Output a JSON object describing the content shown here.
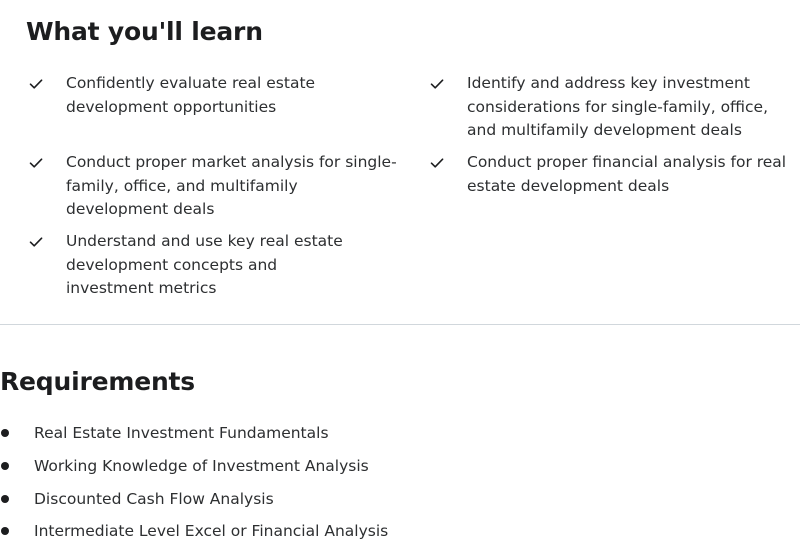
{
  "learn": {
    "title": "What you'll learn",
    "icon": "check-icon",
    "items": [
      {
        "label": "Confidently evaluate real estate development opportunities"
      },
      {
        "label": "Identify and address key investment considerations for single-family, office, and multifamily development deals"
      },
      {
        "label": "Conduct proper market analysis for single-family, office, and multifamily development deals"
      },
      {
        "label": "Conduct proper financial analysis for real estate development deals"
      },
      {
        "label": "Understand and use key real estate development concepts and investment metrics"
      }
    ]
  },
  "requirements": {
    "title": "Requirements",
    "icon": "bullet-icon",
    "items": [
      {
        "label": "Real Estate Investment Fundamentals"
      },
      {
        "label": "Working Knowledge of Investment Analysis"
      },
      {
        "label": "Discounted Cash Flow Analysis"
      },
      {
        "label": "Intermediate Level Excel or Financial Analysis"
      }
    ]
  },
  "colors": {
    "text": "#1c1d1f",
    "body_text": "#2d2f31",
    "divider": "#d1d7dc"
  }
}
